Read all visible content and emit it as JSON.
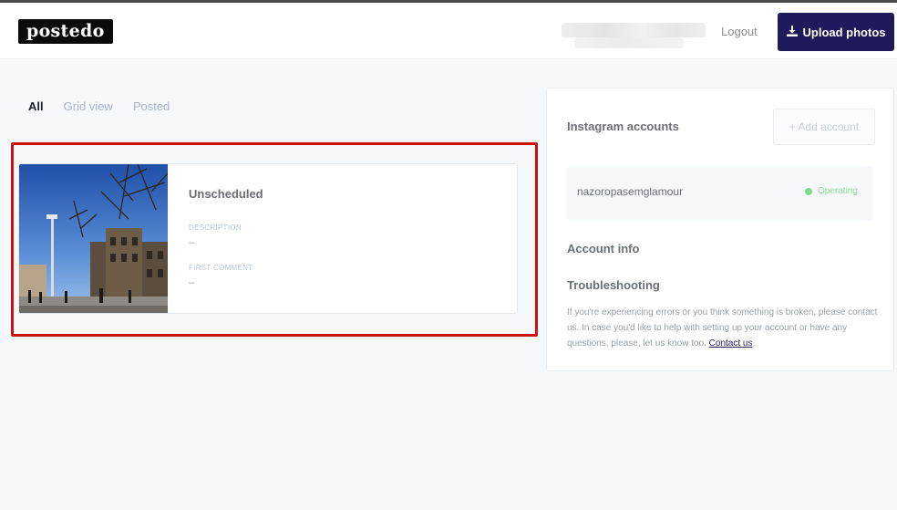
{
  "header": {
    "logo": "postedo",
    "logout_label": "Logout",
    "upload_label": "Upload photos"
  },
  "tabs": [
    {
      "label": "All",
      "active": true
    },
    {
      "label": "Grid view",
      "active": false
    },
    {
      "label": "Posted",
      "active": false
    }
  ],
  "post": {
    "status": "Unscheduled",
    "description_label": "DESCRIPTION",
    "description_value": "–",
    "first_comment_label": "FIRST COMMENT",
    "first_comment_value": "–"
  },
  "sidebar": {
    "instagram_heading": "Instagram accounts",
    "add_account_label": "+ Add account",
    "account": {
      "name": "nazoropasemglamour",
      "status": "Operating"
    },
    "account_info_heading": "Account info",
    "troubleshooting_heading": "Troubleshooting",
    "help_text": "If you're experiencing errors or you think something is broken, please contact us. In case you'd like to help with setting up your account or have any questions, please, let us know too.",
    "contact_link": "Contact us"
  },
  "colors": {
    "brand": "#1f1a5c",
    "highlight": "#cc1111",
    "operating": "#7fdb85",
    "background": "#f6f9fc"
  },
  "icons": {
    "upload": "download-arrow-icon",
    "status": "status-dot-icon"
  }
}
